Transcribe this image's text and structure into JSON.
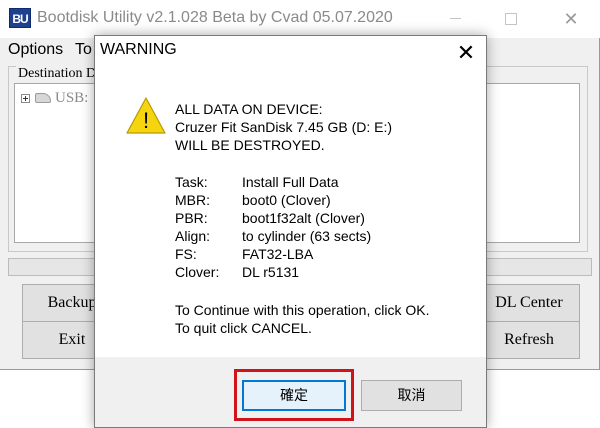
{
  "app": {
    "icon_text": "BU",
    "title": "Bootdisk Utility v2.1.028 Beta by Cvad 05.07.2020",
    "min_glyph": "—",
    "max_glyph": "□",
    "close_glyph": "✕"
  },
  "menu": [
    {
      "label": "Options"
    },
    {
      "label": "To"
    }
  ],
  "destination": {
    "legend": "Destination D",
    "tree_item_label": "USB:"
  },
  "buttons": {
    "backup": "Backup",
    "exit": "Exit",
    "dl_center": "DL Center",
    "refresh": "Refresh"
  },
  "dialog": {
    "title": "WARNING",
    "close_glyph": "✕",
    "icon_symbol": "!",
    "message": [
      "ALL DATA ON DEVICE:",
      "Cruzer Fit SanDisk 7.45 GB (D: E:)",
      "WILL BE DESTROYED."
    ],
    "details": [
      {
        "label": "Task:",
        "value": "Install Full Data"
      },
      {
        "label": "MBR:",
        "value": "boot0 (Clover)"
      },
      {
        "label": "PBR:",
        "value": "boot1f32alt (Clover)"
      },
      {
        "label": "Align:",
        "value": "to cylinder (63 sects)"
      },
      {
        "label": "FS:",
        "value": "FAT32-LBA"
      },
      {
        "label": "Clover:",
        "value": "DL r5131"
      }
    ],
    "instructions": [
      "To Continue with this operation, click OK.",
      "To quit click CANCEL."
    ],
    "ok_label": "確定",
    "cancel_label": "取消"
  },
  "colors": {
    "highlight_border": "#d0121b",
    "ok_focus_border": "#0078d7",
    "warning_fill": "#f5d410"
  }
}
